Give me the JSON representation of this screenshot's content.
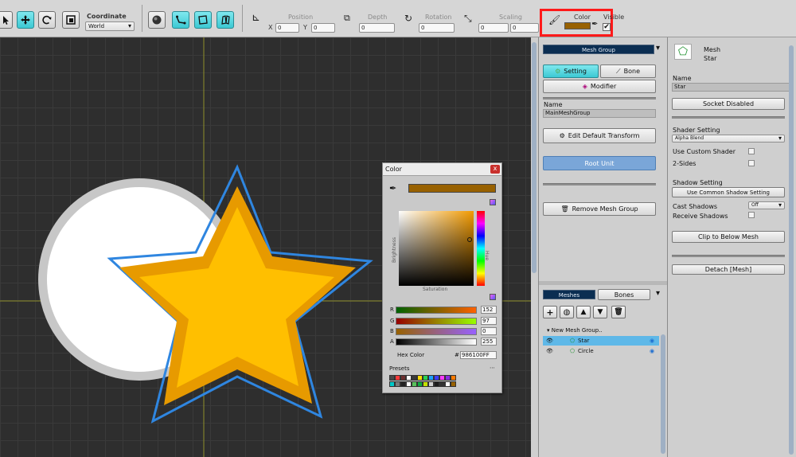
{
  "toolbar": {
    "coordinate_label": "Coordinate",
    "coordinate_value": "World",
    "position_label": "Position",
    "pos_x_label": "X",
    "pos_x": "0",
    "pos_y_label": "Y",
    "pos_y": "0",
    "depth_label": "Depth",
    "depth_value": "0",
    "rotation_label": "Rotation",
    "rotation_value": "0",
    "scaling_label": "Scaling",
    "scale_x": "0",
    "scale_y": "0",
    "color_label": "Color",
    "color_swatch": "#986100",
    "visible_label": "Visible",
    "highlight_color": "#ff1a1a"
  },
  "color_picker": {
    "title": "Color",
    "close": "x",
    "current_color": "#986100",
    "brightness_label": "Brightness",
    "hue_label": "Hue",
    "saturation_label": "Saturation",
    "r_label": "R",
    "r_value": "152",
    "g_label": "G",
    "g_value": "97",
    "b_label": "B",
    "b_value": "0",
    "a_label": "A",
    "a_value": "255",
    "hex_label": "Hex Color",
    "hex_value": "986100FF",
    "presets_label": "Presets",
    "presets": [
      "#4a4a4a",
      "#ff3b3b",
      "#6b2f2f",
      "#ffffff",
      "#3a3a3a",
      "#ffdd00",
      "#2ad24f",
      "#1aa0ff",
      "#3b3bff",
      "#ff3bff",
      "#8a2be2",
      "#ff7a00",
      "#00c8c8",
      "#7a7a7a",
      "#222222",
      "#ffffff",
      "#58c15b",
      "#0ea842",
      "#c4e000",
      "#d0d0d0",
      "#1d1d1d",
      "#333333",
      "#ffffff",
      "#986100"
    ]
  },
  "mesh_group_panel": {
    "header": "Mesh Group",
    "tab_setting": "Setting",
    "tab_bone": "Bone",
    "modifier_btn": "Modifier",
    "name_label": "Name",
    "name_value": "MainMeshGroup",
    "edit_default_transform": "Edit Default Transform",
    "root_unit": "Root Unit",
    "remove_mesh_group": "Remove Mesh Group",
    "tab_meshes": "Meshes",
    "tab_bones": "Bones",
    "tree_root": "New Mesh Group..",
    "tree_items": [
      "Star",
      "Circle"
    ]
  },
  "mesh_panel": {
    "type": "Mesh",
    "name_preview": "Star",
    "name_label": "Name",
    "name_value": "Star",
    "socket_btn": "Socket Disabled",
    "shader_label": "Shader Setting",
    "shader_value": "Alpha Blend",
    "custom_shader": "Use Custom Shader",
    "two_sides": "2-Sides",
    "shadow_label": "Shadow Setting",
    "use_common_shadow": "Use Common Shadow Setting",
    "cast_shadows": "Cast Shadows",
    "cast_value": "Off",
    "receive_shadows": "Receive Shadows",
    "clip_btn": "Clip to Below Mesh",
    "detach_btn": "Detach [Mesh]"
  },
  "scene": {
    "circle_fill": "#ffffff",
    "circle_ring": "#c7c7c7",
    "star_outer": "#e79a00",
    "star_inner": "#ffbf00",
    "selection_outline": "#2f86e0",
    "axis_color": "#8f8f2a"
  }
}
